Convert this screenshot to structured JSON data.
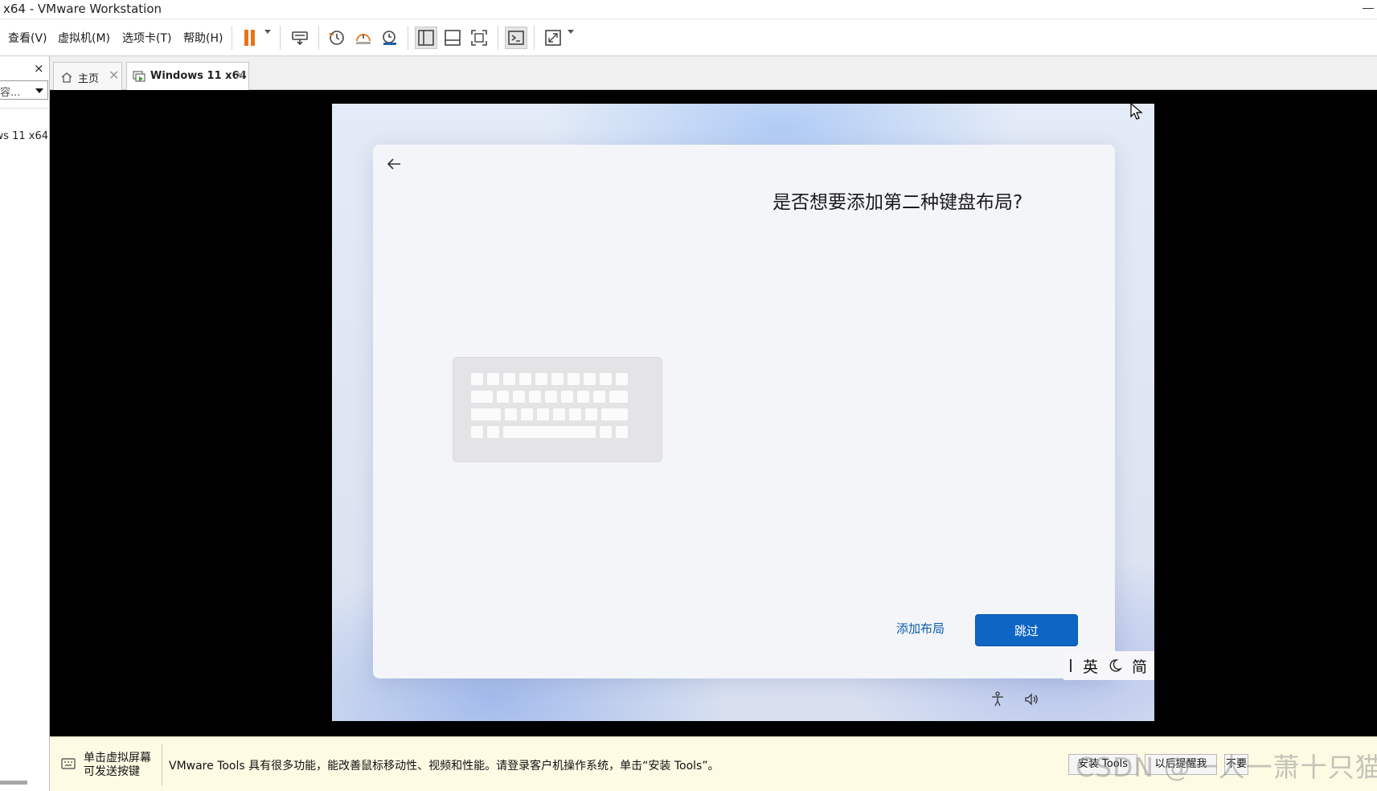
{
  "window": {
    "title": "x64 - VMware Workstation"
  },
  "menu": {
    "view": "查看(V)",
    "vm": "虚拟机(M)",
    "tabs": "选项卡(T)",
    "help": "帮助(H)"
  },
  "toolbar": {
    "icons": [
      "pause-icon",
      "send-ctrl-alt-del-icon",
      "snapshot-icon",
      "revert-snapshot-icon",
      "snapshot-manager-icon",
      "library-view-icon",
      "thumbnail-view-icon",
      "fullscreen-fit-icon",
      "console-view-icon",
      "enter-fullscreen-icon"
    ],
    "accent": "#e8731a"
  },
  "library": {
    "close": "×",
    "search_text": "容...",
    "vm_item": "ws 11 x64"
  },
  "tabs": [
    {
      "label": "主页",
      "close": "✕"
    },
    {
      "label": "Windows 11 x64",
      "close": "✕"
    }
  ],
  "oobe": {
    "title": "是否想要添加第二种键盘布局?",
    "add_layout": "添加布局",
    "skip": "跳过",
    "primary_color": "#0f65c4",
    "ime": {
      "lang": "英",
      "mode": "简"
    }
  },
  "notice": {
    "click_hint_line1": "单击虚拟屏幕",
    "click_hint_line2": "可发送按键",
    "message": "VMware Tools 具有很多功能，能改善鼠标移动性、视频和性能。请登录客户机操作系统，单击“安装 Tools”。",
    "install_tools": "安装 Tools",
    "remind_later": "以后提醒我",
    "never": "不要"
  },
  "watermark": "CSDN @一人一萧十只猫"
}
